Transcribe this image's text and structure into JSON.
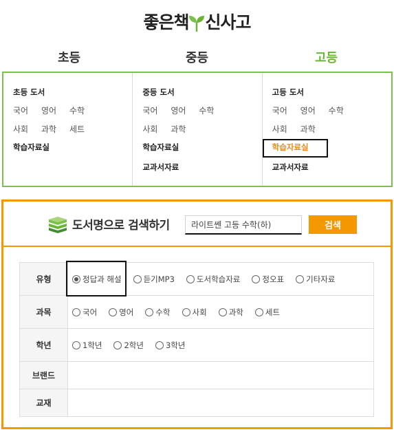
{
  "logo": {
    "text_left": "좋은책",
    "text_right": "신사고"
  },
  "levels": [
    {
      "label": "초등",
      "active": false
    },
    {
      "label": "중등",
      "active": false
    },
    {
      "label": "고등",
      "active": true
    }
  ],
  "menu": {
    "elementary": {
      "title": "초등 도서",
      "row1": [
        "국어",
        "영어",
        "수학"
      ],
      "row2": [
        "사회",
        "과학",
        "세트"
      ],
      "study": "학습자료실"
    },
    "middle": {
      "title": "중등 도서",
      "row1": [
        "국어",
        "영어",
        "수학"
      ],
      "row2": [
        "사회",
        "과학"
      ],
      "study": "학습자료실",
      "textbook": "교과서자료"
    },
    "high": {
      "title": "고등 도서",
      "row1": [
        "국어",
        "영어",
        "수학"
      ],
      "row2": [
        "사회",
        "과학"
      ],
      "study": "학습자료실",
      "textbook": "교과서자료"
    }
  },
  "search": {
    "title": "도서명으로 검색하기",
    "input_value": "라이트쎈 고등 수학(하)",
    "button": "검색"
  },
  "filters": {
    "type": {
      "label": "유형",
      "options": [
        "정답과 해설",
        "듣기MP3",
        "도서학습자료",
        "정오표",
        "기타자료"
      ],
      "selected": "정답과 해설"
    },
    "subject": {
      "label": "과목",
      "options": [
        "국어",
        "영어",
        "수학",
        "사회",
        "과학",
        "세트"
      ]
    },
    "grade": {
      "label": "학년",
      "options": [
        "1학년",
        "2학년",
        "3학년"
      ]
    },
    "brand": {
      "label": "브랜드"
    },
    "textbook": {
      "label": "교재"
    }
  },
  "colors": {
    "green": "#7bc04a",
    "active_green": "#6ab534",
    "orange": "#f39800"
  }
}
